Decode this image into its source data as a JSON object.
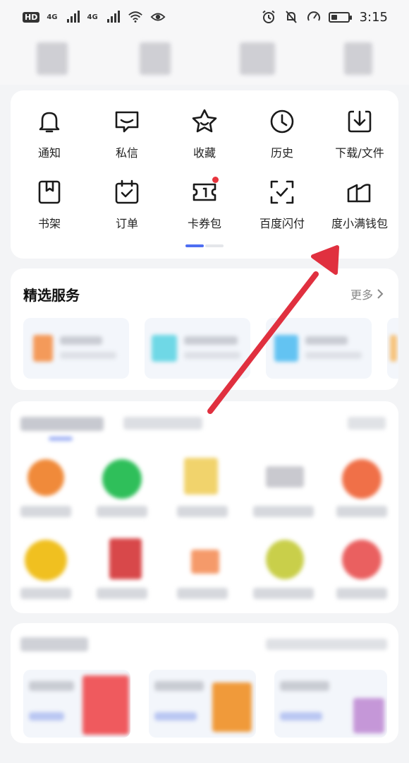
{
  "status_bar": {
    "network": "HD",
    "signal1": "4G",
    "signal2": "4G",
    "time": "3:15",
    "battery_level": 0.3
  },
  "shortcuts": [
    {
      "label": "通知",
      "icon": "bell-icon"
    },
    {
      "label": "私信",
      "icon": "message-icon"
    },
    {
      "label": "收藏",
      "icon": "star-icon"
    },
    {
      "label": "历史",
      "icon": "clock-icon"
    },
    {
      "label": "下载/文件",
      "icon": "download-icon"
    },
    {
      "label": "书架",
      "icon": "bookshelf-icon"
    },
    {
      "label": "订单",
      "icon": "calendar-check-icon"
    },
    {
      "label": "卡券包",
      "icon": "ticket-icon"
    },
    {
      "label": "百度闪付",
      "icon": "scan-pay-icon"
    },
    {
      "label": "度小满钱包",
      "icon": "wallet-icon"
    }
  ],
  "featured": {
    "title": "精选服务",
    "more": "更多"
  },
  "colors": {
    "accent": "#4e6ef2",
    "notification_dot": "#e8343d",
    "annotation_arrow": "#e0303f"
  }
}
